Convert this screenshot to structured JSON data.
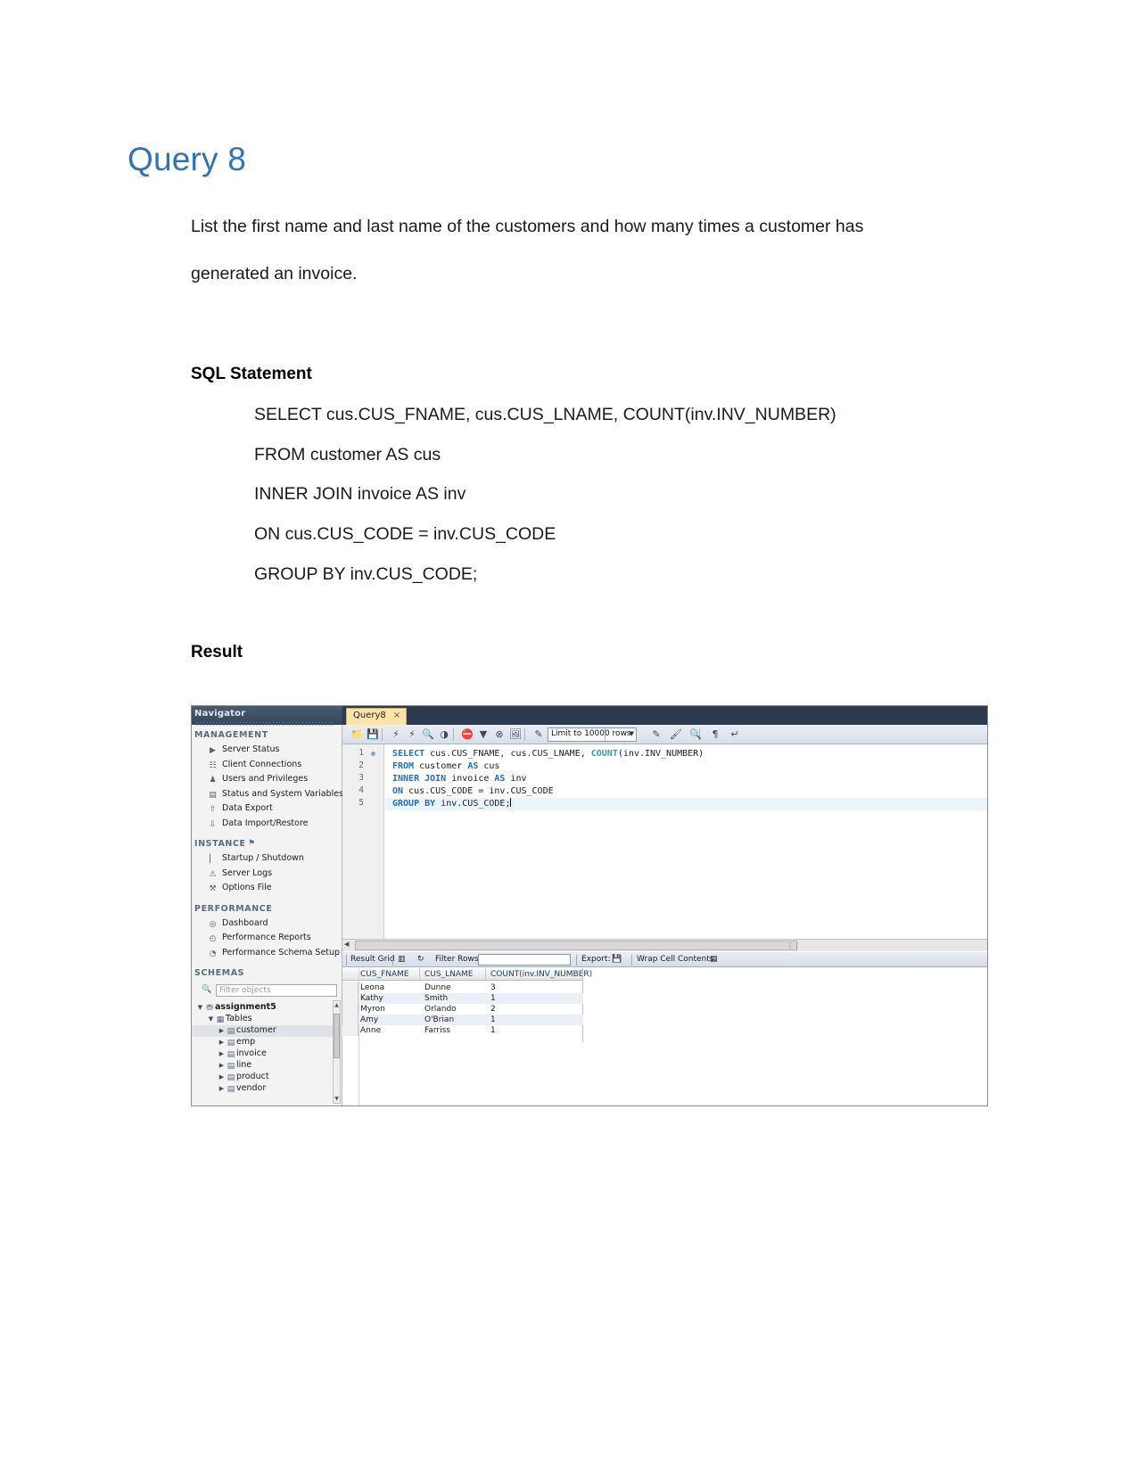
{
  "document": {
    "title": "Query 8",
    "description_line1": "List the first name and last name of the customers and how many times a customer has",
    "description_line2": "generated an invoice.",
    "sql_heading": "SQL Statement",
    "result_heading": "Result",
    "sql_lines": [
      "SELECT cus.CUS_FNAME, cus.CUS_LNAME, COUNT(inv.INV_NUMBER)",
      "FROM customer AS cus",
      "INNER JOIN invoice AS inv",
      "ON cus.CUS_CODE = inv.CUS_CODE",
      "GROUP BY inv.CUS_CODE;"
    ]
  },
  "workbench": {
    "navigator": {
      "title": "Navigator",
      "title_dots": "::::::::::::::::::::::::::::::::::::::::::",
      "groups": [
        {
          "label": "MANAGEMENT",
          "expand_icon": "expand-icon"
        },
        {
          "label": "INSTANCE",
          "expand_icon": "instance-icon"
        },
        {
          "label": "PERFORMANCE",
          "expand_icon": ""
        },
        {
          "label": "SCHEMAS",
          "expand_icon": "refresh-icon"
        }
      ],
      "management_items": [
        {
          "label": "Server Status",
          "icon": "server-status-icon"
        },
        {
          "label": "Client Connections",
          "icon": "client-connections-icon"
        },
        {
          "label": "Users and Privileges",
          "icon": "users-privileges-icon"
        },
        {
          "label": "Status and System Variables",
          "icon": "status-variables-icon"
        },
        {
          "label": "Data Export",
          "icon": "data-export-icon"
        },
        {
          "label": "Data Import/Restore",
          "icon": "data-import-icon"
        }
      ],
      "instance_items": [
        {
          "label": "Startup / Shutdown",
          "icon": "startup-shutdown-icon"
        },
        {
          "label": "Server Logs",
          "icon": "server-logs-icon"
        },
        {
          "label": "Options File",
          "icon": "options-file-icon"
        }
      ],
      "performance_items": [
        {
          "label": "Dashboard",
          "icon": "dashboard-icon"
        },
        {
          "label": "Performance Reports",
          "icon": "performance-reports-icon"
        },
        {
          "label": "Performance Schema Setup",
          "icon": "performance-schema-icon"
        }
      ],
      "filter_placeholder": "Filter objects",
      "tree": [
        {
          "label": "assignment5",
          "level": 0,
          "icon": "schema-icon",
          "twisty": "▼",
          "bold": true,
          "selected": false
        },
        {
          "label": "Tables",
          "level": 1,
          "icon": "tables-folder-icon",
          "twisty": "▼",
          "bold": false,
          "selected": false
        },
        {
          "label": "customer",
          "level": 2,
          "icon": "table-icon",
          "twisty": "▶",
          "bold": false,
          "selected": true
        },
        {
          "label": "emp",
          "level": 2,
          "icon": "table-icon",
          "twisty": "▶",
          "bold": false,
          "selected": false
        },
        {
          "label": "invoice",
          "level": 2,
          "icon": "table-icon",
          "twisty": "▶",
          "bold": false,
          "selected": false
        },
        {
          "label": "line",
          "level": 2,
          "icon": "table-icon",
          "twisty": "▶",
          "bold": false,
          "selected": false
        },
        {
          "label": "product",
          "level": 2,
          "icon": "table-icon",
          "twisty": "▶",
          "bold": false,
          "selected": false
        },
        {
          "label": "vendor",
          "level": 2,
          "icon": "table-icon",
          "twisty": "▶",
          "bold": false,
          "selected": false
        }
      ]
    },
    "editor": {
      "tab_label": "Query8",
      "tab_close": "×",
      "toolbar": {
        "limit_label": "Limit to 10000 rows",
        "buttons": [
          "open-file-icon",
          "save-file-icon",
          "execute-icon",
          "execute-current-icon",
          "explain-icon",
          "stop-on-error-icon",
          "toggle-breakpoint-icon",
          "continue-icon",
          "stop-icon",
          "commit-icon",
          "beautify-icon",
          "find-icon",
          "search-icon",
          "toggle-invisible-icon",
          "wrap-lines-icon"
        ]
      },
      "lines": [
        {
          "n": "1",
          "marker": true,
          "current": false,
          "tokens": [
            {
              "t": "SELECT",
              "c": "kw"
            },
            {
              "t": " cus.CUS_FNAME, cus.CUS_LNAME, ",
              "c": "id"
            },
            {
              "t": "COUNT",
              "c": "fn"
            },
            {
              "t": "(inv.INV_NUMBER)",
              "c": "id"
            }
          ]
        },
        {
          "n": "2",
          "marker": false,
          "current": false,
          "tokens": [
            {
              "t": "FROM",
              "c": "kw"
            },
            {
              "t": " customer ",
              "c": "id"
            },
            {
              "t": "AS",
              "c": "kw"
            },
            {
              "t": " cus",
              "c": "id"
            }
          ]
        },
        {
          "n": "3",
          "marker": false,
          "current": false,
          "tokens": [
            {
              "t": "INNER JOIN",
              "c": "kw"
            },
            {
              "t": " invoice ",
              "c": "id"
            },
            {
              "t": "AS",
              "c": "kw"
            },
            {
              "t": " inv",
              "c": "id"
            }
          ]
        },
        {
          "n": "4",
          "marker": false,
          "current": false,
          "tokens": [
            {
              "t": "ON",
              "c": "kw"
            },
            {
              "t": " cus.CUS_CODE = inv.CUS_CODE",
              "c": "id"
            }
          ]
        },
        {
          "n": "5",
          "marker": false,
          "current": true,
          "tokens": [
            {
              "t": "GROUP BY",
              "c": "kw"
            },
            {
              "t": " inv.CUS_CODE;",
              "c": "id"
            }
          ]
        }
      ]
    },
    "results_toolbar": {
      "result_grid_label": "Result Grid",
      "grid_view_icon": "grid-view-icon",
      "refresh_icon": "refresh-results-icon",
      "filter_label": "Filter Rows:",
      "filter_value": "",
      "export_label": "Export:",
      "export_icon": "export-icon",
      "wrap_label": "Wrap Cell Contents:",
      "wrap_icon": "wrap-cell-icon"
    },
    "result_grid": {
      "columns": [
        "CUS_FNAME",
        "CUS_LNAME",
        "COUNT(inv.INV_NUMBER)"
      ],
      "rows": [
        [
          "Leona",
          "Dunne",
          "3"
        ],
        [
          "Kathy",
          "Smith",
          "1"
        ],
        [
          "Myron",
          "Orlando",
          "2"
        ],
        [
          "Amy",
          "O'Brian",
          "1"
        ],
        [
          "Anne",
          "Farriss",
          "1"
        ]
      ]
    }
  },
  "colors": {
    "heading": "#2E74B5",
    "chrome_dark": "#2b3a4d",
    "tab_active": "#fbe3aa",
    "keyword": "#1f6fc4",
    "function": "#2aa1b3",
    "current_line": "#eaf4fb"
  }
}
